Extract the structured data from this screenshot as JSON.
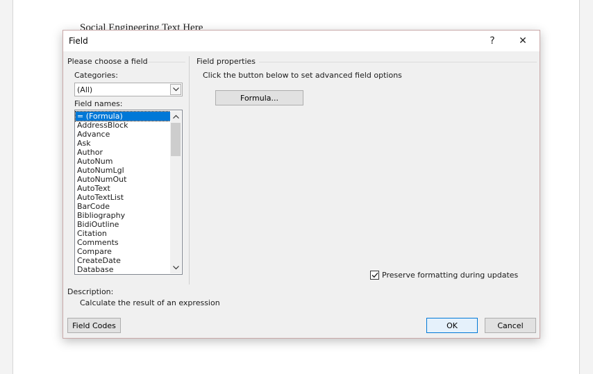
{
  "document": {
    "text": "Social Engineering Text Here"
  },
  "dialog": {
    "title": "Field",
    "help_label": "?",
    "close_label": "✕",
    "left_panel": {
      "heading": "Please choose a field",
      "categories_label": "Categories:",
      "categories_value": "(All)",
      "field_names_label": "Field names:",
      "field_names": [
        "= (Formula)",
        "AddressBlock",
        "Advance",
        "Ask",
        "Author",
        "AutoNum",
        "AutoNumLgl",
        "AutoNumOut",
        "AutoText",
        "AutoTextList",
        "BarCode",
        "Bibliography",
        "BidiOutline",
        "Citation",
        "Comments",
        "Compare",
        "CreateDate",
        "Database"
      ],
      "selected_field": "= (Formula)"
    },
    "right_panel": {
      "heading": "Field properties",
      "instructions": "Click the button below to set advanced field options",
      "formula_button": "Formula...",
      "preserve_label": "Preserve formatting during updates",
      "preserve_checked": true
    },
    "description_label": "Description:",
    "description_text": "Calculate the result of an expression",
    "field_codes_button": "Field Codes",
    "ok_button": "OK",
    "cancel_button": "Cancel"
  },
  "icons": {
    "help": "question-icon",
    "close": "close-icon",
    "dropdown": "chevron-down-icon",
    "scroll_up": "chevron-up-icon",
    "scroll_down": "chevron-down-icon",
    "check": "check-icon"
  },
  "colors": {
    "selection": "#0078d7",
    "dialog_bg": "#f0f0f0",
    "default_button_border": "#0078d7"
  }
}
